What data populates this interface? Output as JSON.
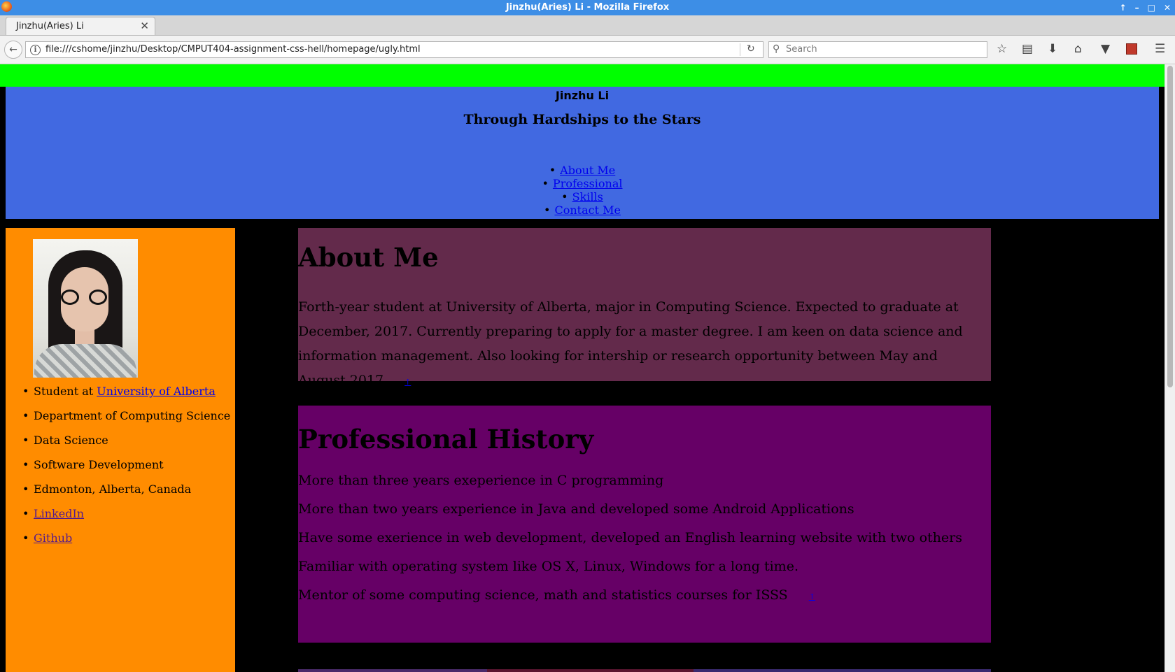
{
  "window": {
    "title": "Jinzhu(Aries) Li - Mozilla Firefox",
    "controls": [
      "↑",
      "–",
      "□",
      "✕"
    ]
  },
  "tabs": {
    "active_title": "Jinzhu(Aries) Li",
    "close_glyph": "✕",
    "new_tab_glyph": "+"
  },
  "toolbar": {
    "back_glyph": "←",
    "url": "file:///cshome/jinzhu/Desktop/CMPUT404-assignment-css-hell/homepage/ugly.html",
    "reload_glyph": "↻",
    "search_placeholder": "Search",
    "icons": [
      "bookmark-star",
      "library",
      "download",
      "home",
      "pocket",
      "extension",
      "hamburger-menu"
    ]
  },
  "colors": {
    "top_bar": "#00ff00",
    "header": "#4169e1",
    "sidebar": "#ff8c00",
    "about": "#632a4b",
    "professional": "#660066",
    "page_bg": "#000000"
  },
  "header": {
    "name": "Jinzhu Li",
    "tagline": "Through Hardships to the Stars",
    "nav": [
      "About Me",
      "Professional",
      "Skills",
      "Contact Me"
    ]
  },
  "sidebar": {
    "student_prefix": "Student at ",
    "university_link": "University of Alberta",
    "facts": [
      "Department of Computing Science",
      "Data Science",
      "Software Development",
      "Edmonton, Alberta, Canada"
    ],
    "linkedin": "LinkedIn",
    "github": "Github"
  },
  "about": {
    "heading": "About Me",
    "text": "Forth-year student at University of Alberta, major in Computing Science. Expected to graduate at December, 2017. Currently preparing to apply for a master degree. I am keen on data science and information management. Also looking for intership or research opportunity between May and August 2017",
    "up_link": "↑"
  },
  "professional": {
    "heading": "Professional History",
    "lines": [
      "More than three years exeperience in C programming",
      "More than two years experience in Java and developed some Android Applications",
      "Have some exerience in web development, developed an English learning website with two others",
      "Familiar with operating system like OS X, Linux, Windows for a long time.",
      "Mentor of some computing science, math and statistics courses for ISSS"
    ],
    "up_link": "↑"
  }
}
